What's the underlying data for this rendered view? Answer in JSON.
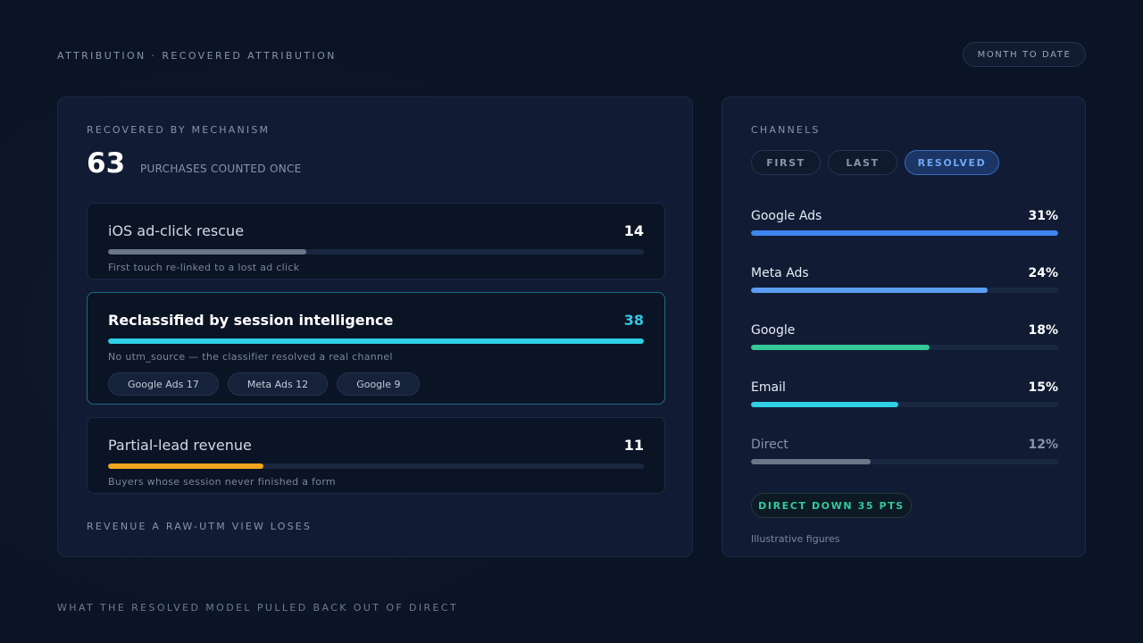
{
  "header": {
    "breadcrumb": "ATTRIBUTION · RECOVERED ATTRIBUTION",
    "range_label": "MONTH TO DATE"
  },
  "left_panel": {
    "section_label": "RECOVERED BY MECHANISM",
    "total": "63",
    "total_caption": "PURCHASES COUNTED ONCE",
    "mechanisms": [
      {
        "title": "iOS ad-click rescue",
        "value": "14",
        "progress": 0.37,
        "color": "#6b7689",
        "description": "First touch re-linked to a lost ad click"
      },
      {
        "title": "Reclassified by session intelligence",
        "value": "38",
        "progress": 1.0,
        "color": "#2fcfe6",
        "description": "No utm_source — the classifier resolved a real channel",
        "chips": [
          "Google Ads 17",
          "Meta Ads 12",
          "Google 9"
        ]
      },
      {
        "title": "Partial-lead revenue",
        "value": "11",
        "progress": 0.29,
        "color": "#f2a51c",
        "description": "Buyers whose session never finished a form"
      }
    ],
    "bottom_label": "REVENUE A RAW-UTM VIEW LOSES"
  },
  "right_panel": {
    "section_label": "CHANNELS",
    "tabs": [
      {
        "label": "FIRST",
        "active": false
      },
      {
        "label": "LAST",
        "active": false
      },
      {
        "label": "RESOLVED",
        "active": true
      }
    ],
    "channels": [
      {
        "name": "Google Ads",
        "pct": "31%",
        "share": 1.0,
        "color": "#3f86f0"
      },
      {
        "name": "Meta Ads",
        "pct": "24%",
        "share": 0.77,
        "color": "#5a9df2"
      },
      {
        "name": "Google",
        "pct": "18%",
        "share": 0.58,
        "color": "#35c99a"
      },
      {
        "name": "Email",
        "pct": "15%",
        "share": 0.48,
        "color": "#2fcfe6"
      },
      {
        "name": "Direct",
        "pct": "12%",
        "share": 0.39,
        "color": "#6b7689",
        "dim": true
      }
    ],
    "delta_badge": "DIRECT DOWN 35 PTS",
    "footnote": "Illustrative figures"
  },
  "footer": {
    "caption": "WHAT THE RESOLVED MODEL PULLED BACK OUT OF DIRECT"
  }
}
